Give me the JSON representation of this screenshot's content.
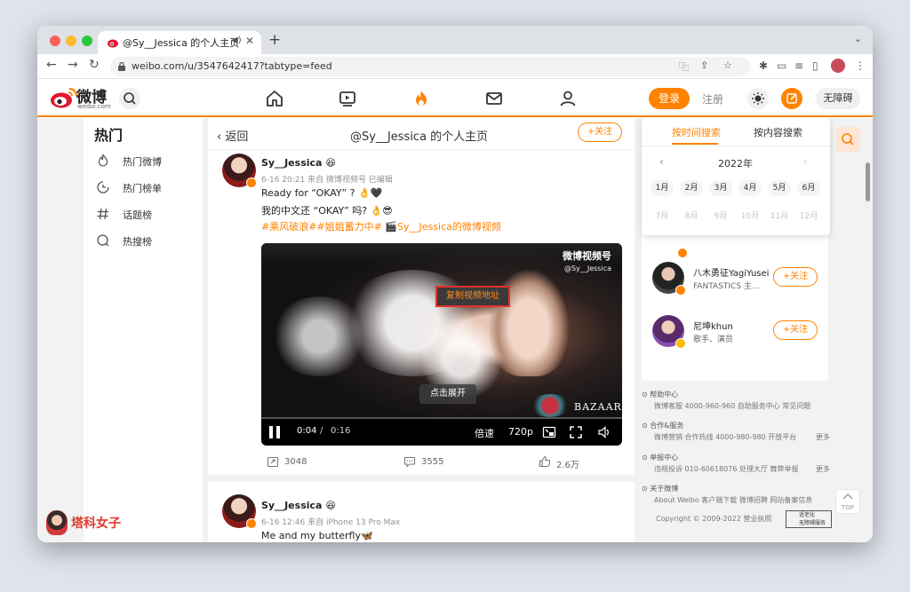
{
  "browser": {
    "tab_title": "@Sy__Jessica 的个人主页",
    "url": "weibo.com/u/3547642417?tabtype=feed"
  },
  "header": {
    "logo_text": "微博",
    "logo_sub": "weibo.com",
    "login_label": "登录",
    "register_label": "注册",
    "accessibility_label": "无障碍",
    "accent_color": "#ff8200"
  },
  "leftnav": {
    "title": "热门",
    "items": [
      {
        "label": "热门微博",
        "icon": "fire-icon"
      },
      {
        "label": "热门榜单",
        "icon": "chart-ring-icon"
      },
      {
        "label": "话题榜",
        "icon": "hashtag-icon"
      },
      {
        "label": "热搜榜",
        "icon": "search-ring-icon"
      }
    ]
  },
  "feed": {
    "back_label": "返回",
    "page_title": "@Sy__Jessica 的个人主页",
    "follow_label": "+关注",
    "post1": {
      "author": "Sy__Jessica",
      "emoji": "😆",
      "meta": "6-16 20:21  来自 微博视频号  已编辑",
      "line1": "Ready for “OKAY” ? 👌🖤",
      "line2": "我的中文还 “OKAY” 吗? 👌😎",
      "tags": "#乘风破浪##姐姐蓄力中# 🎬Sy__Jessica的微博视频",
      "video": {
        "watermark_title": "微博视频号",
        "watermark_handle": "@Sy__Jessica",
        "copy_address": "复制视频地址",
        "expand": "点击展开",
        "brand": "BAZAAR",
        "time_current": "0:04",
        "time_sep": "/",
        "time_total": "0:16",
        "speed": "倍速",
        "quality": "720p"
      },
      "actions": {
        "reposts": "3048",
        "comments": "3555",
        "likes": "2.6万"
      }
    },
    "post2": {
      "author": "Sy__Jessica",
      "emoji": "😆",
      "meta": "6-16 12:46  来自 iPhone 13 Pro Max",
      "line1": "Me and my butterfly🦋"
    }
  },
  "calendar": {
    "tab_time": "按时间搜索",
    "tab_content": "按内容搜索",
    "year": "2022年",
    "prev": "‹",
    "next": "›",
    "months_active": [
      "1月",
      "2月",
      "3月",
      "4月",
      "5月",
      "6月"
    ],
    "months_inactive": [
      "7月",
      "8月",
      "9月",
      "10月",
      "11月",
      "12月"
    ]
  },
  "recommend": [
    {
      "name": "八木勇征YagiYusei",
      "desc": "FANTASTICS 主...",
      "follow": "+关注"
    },
    {
      "name": "尼坤khun",
      "desc": "歌手、演员",
      "follow": "+关注"
    }
  ],
  "footer": {
    "help_head": "帮助中心",
    "help_line": "微博客服 4000-960-960    自助服务中心    常见问题",
    "coop_head": "合作&服务",
    "coop_line": "微博营销    合作热线 4000-980-980    开放平台",
    "coop_more": "更多",
    "report_head": "举报中心",
    "report_line": "违规投诉 010-60618076    处理大厅    舞弊举报",
    "report_more": "更多",
    "about_head": "关于微博",
    "about_line": "About Weibo    客户端下载    微博招聘    网站备案信息",
    "copyright": "Copyright © 2009-2022 营业执照",
    "age_badge_line1": "适老化",
    "age_badge_line2": "无障碍服务",
    "top_label": "TOP"
  },
  "site_watermark": {
    "text": "塔科女子"
  }
}
